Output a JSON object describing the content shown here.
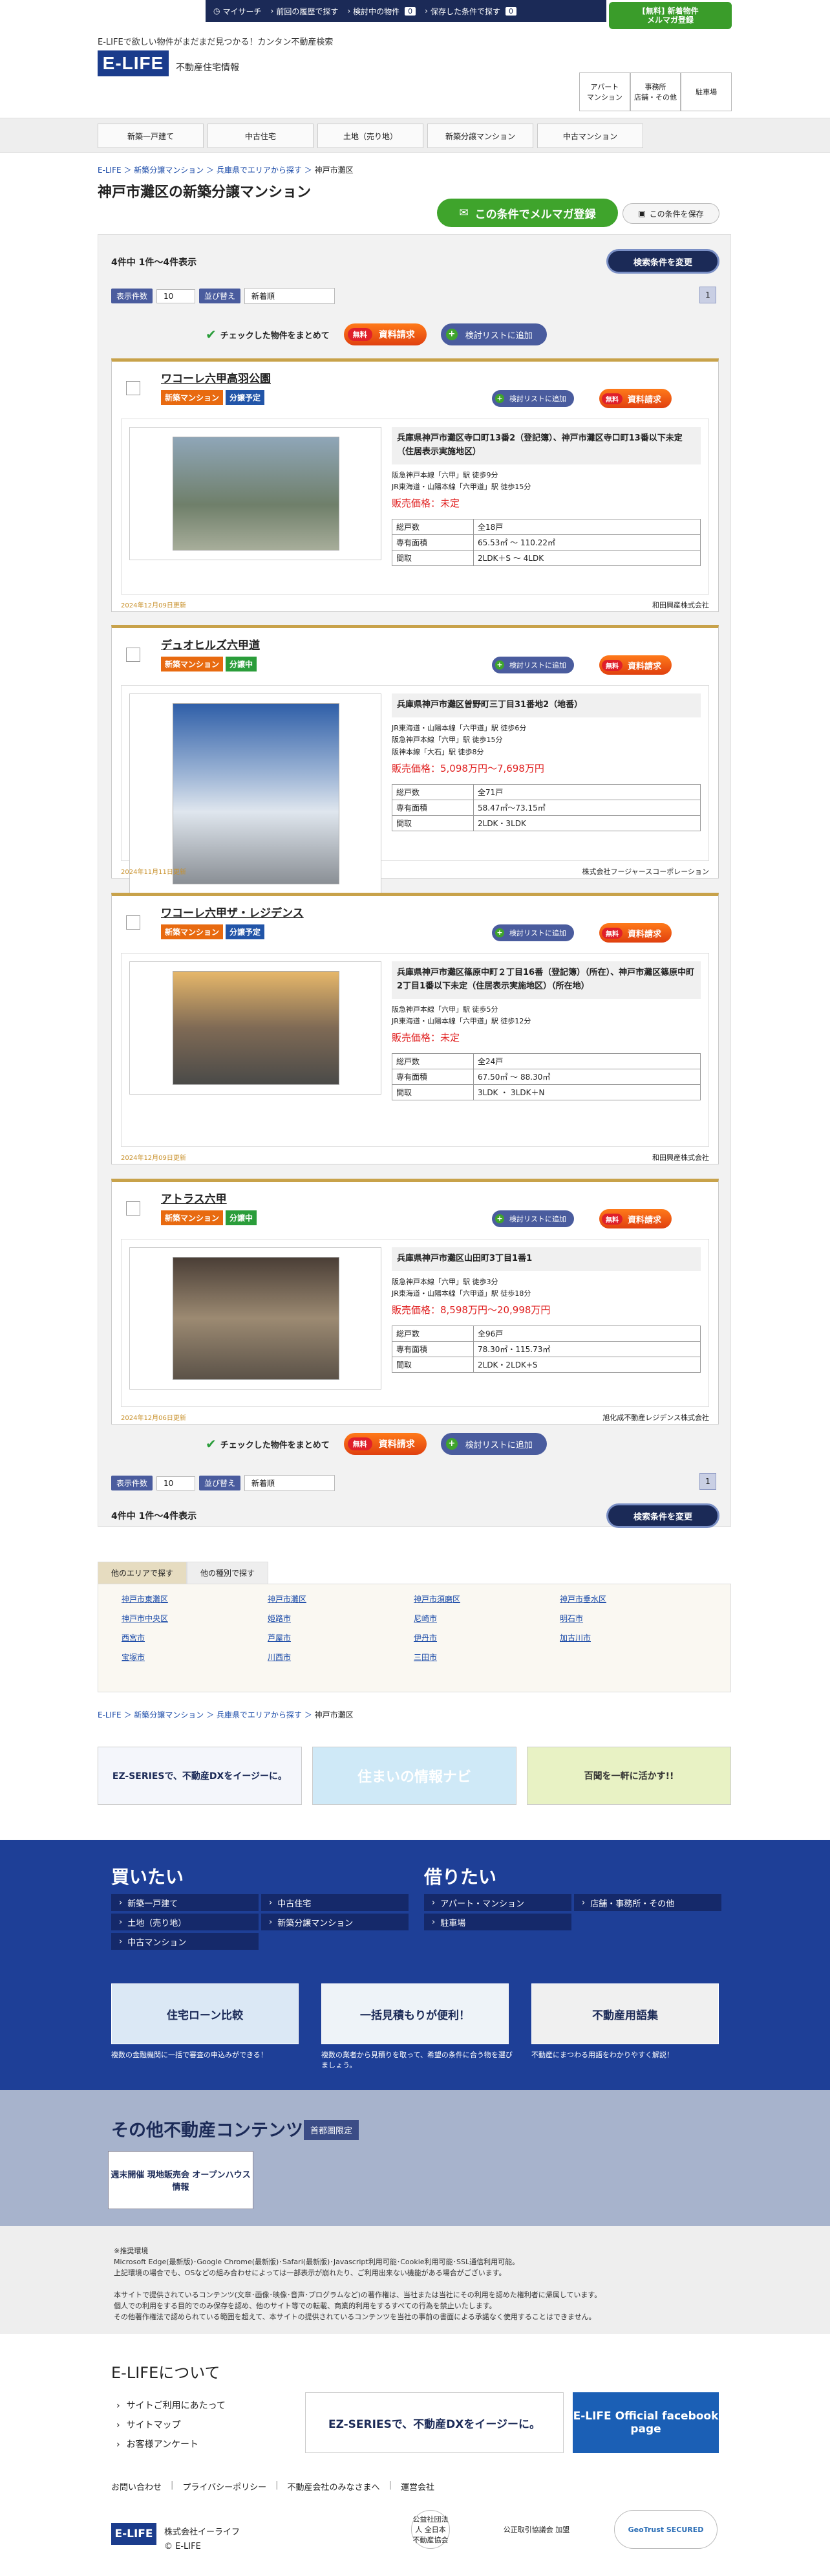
{
  "topnav": {
    "mysearch": "マイサーチ",
    "history": "前回の履歴で探す",
    "considering": "検討中の物件",
    "considering_count": "0",
    "saved": "保存した条件で探す",
    "saved_count": "0",
    "mail_top": "[無料] 新着物件",
    "mail_bottom": "メルマガ登録"
  },
  "header": {
    "tagline": "E-LIFEで欲しい物件がまだまだ見つかる！カンタン不動産検索",
    "logo": "E-LIFE",
    "logo_sub": "不動産住宅情報",
    "boxes": [
      "アパート\nマンション",
      "事務所\n店舗・その他",
      "駐車場"
    ]
  },
  "gnav": [
    "新築一戸建て",
    "中古住宅",
    "土地（売り地）",
    "新築分譲マンション",
    "中古マンション"
  ],
  "breadcrumb": [
    "E-LIFE",
    "新築分譲マンション",
    "兵庫県でエリアから探す",
    "神戸市灘区"
  ],
  "page_title": "神戸市灘区の新築分譲マンション",
  "buttons": {
    "mail_condition": "この条件でメルマガ登録",
    "save_condition": "この条件を保存",
    "change_condition": "検索条件を変更",
    "check_bulk": "チェックした物件をまとめて",
    "free": "無料",
    "request": "資料請求",
    "add_list": "検討リストに追加"
  },
  "result": {
    "count_label": "4件中 1件～4件表示",
    "per_page_label": "表示件数",
    "per_page_value": "10",
    "sort_label": "並び替え",
    "sort_value": "新着順",
    "page": "1"
  },
  "listings": [
    {
      "name": "ワコーレ六甲高羽公園",
      "tags": [
        {
          "text": "新築マンション",
          "c": "o"
        },
        {
          "text": "分譲予定",
          "c": "b"
        }
      ],
      "address": "兵庫県神戸市灘区寺口町13番2（登記簿）、神戸市灘区寺口町13番以下未定（住居表示実施地区）",
      "access": [
        "阪急神戸本線「六甲」駅 徒歩9分",
        "JR東海道・山陽本線「六甲道」駅 徒歩15分"
      ],
      "price": "販売価格：未定",
      "rows": [
        [
          "総戸数",
          "全18戸"
        ],
        [
          "専有面積",
          "65.53㎡ ～ 110.22㎡"
        ],
        [
          "間取",
          "2LDK＋S ～ 4LDK"
        ]
      ],
      "updated": "2024年12月09日更新",
      "company": "和田興産株式会社"
    },
    {
      "name": "デュオヒルズ六甲道",
      "tags": [
        {
          "text": "新築マンション",
          "c": "o"
        },
        {
          "text": "分譲中",
          "c": "g"
        }
      ],
      "address": "兵庫県神戸市灘区曽野町三丁目31番地2（地番）",
      "access": [
        "JR東海道・山陽本線「六甲道」駅 徒歩6分",
        "阪急神戸本線「六甲」駅 徒歩15分",
        "阪神本線「大石」駅 徒歩8分"
      ],
      "price": "販売価格：5,098万円～7,698万円",
      "rows": [
        [
          "総戸数",
          "全71戸"
        ],
        [
          "専有面積",
          "58.47㎡～73.15㎡"
        ],
        [
          "間取",
          "2LDK・3LDK"
        ]
      ],
      "updated": "2024年11月11日更新",
      "company": "株式会社フージャースコーポレーション"
    },
    {
      "name": "ワコーレ六甲ザ・レジデンス",
      "tags": [
        {
          "text": "新築マンション",
          "c": "o"
        },
        {
          "text": "分譲予定",
          "c": "b"
        }
      ],
      "address": "兵庫県神戸市灘区篠原中町２丁目16番（登記簿）（所在）、神戸市灘区篠原中町2丁目1番以下未定（住居表示実施地区）（所在地）",
      "access": [
        "阪急神戸本線「六甲」駅 徒歩5分",
        "JR東海道・山陽本線「六甲道」駅 徒歩12分"
      ],
      "price": "販売価格：未定",
      "rows": [
        [
          "総戸数",
          "全24戸"
        ],
        [
          "専有面積",
          "67.50㎡ ～ 88.30㎡"
        ],
        [
          "間取",
          "3LDK ・ 3LDK＋N"
        ]
      ],
      "updated": "2024年12月09日更新",
      "company": "和田興産株式会社"
    },
    {
      "name": "アトラス六甲",
      "tags": [
        {
          "text": "新築マンション",
          "c": "o"
        },
        {
          "text": "分譲中",
          "c": "g"
        }
      ],
      "address": "兵庫県神戸市灘区山田町3丁目1番1",
      "access": [
        "阪急神戸本線「六甲」駅 徒歩3分",
        "JR東海道・山陽本線「六甲道」駅 徒歩18分"
      ],
      "price": "販売価格：8,598万円～20,998万円",
      "rows": [
        [
          "総戸数",
          "全96戸"
        ],
        [
          "専有面積",
          "78.30㎡・115.73㎡"
        ],
        [
          "間取",
          "2LDK・2LDK+S"
        ]
      ],
      "updated": "2024年12月06日更新",
      "company": "旭化成不動産レジデンス株式会社"
    }
  ],
  "area_tabs": [
    "他のエリアで探す",
    "他の種別で探す"
  ],
  "areas": [
    "神戸市東灘区",
    "神戸市灘区",
    "神戸市須磨区",
    "神戸市垂水区",
    "神戸市中央区",
    "姫路市",
    "尼崎市",
    "明石市",
    "西宮市",
    "芦屋市",
    "伊丹市",
    "加古川市",
    "宝塚市",
    "川西市",
    "三田市"
  ],
  "banners": [
    "EZ-SERIESで、不動産DXをイージーに。",
    "住まいの情報ナビ",
    "百聞を一軒に活かす!!"
  ],
  "buy": {
    "title": "買いたい",
    "links": [
      "新築一戸建て",
      "中古住宅",
      "土地（売り地）",
      "新築分譲マンション",
      "中古マンション"
    ]
  },
  "rent": {
    "title": "借りたい",
    "links": [
      "アパート・マンション",
      "店舗・事務所・その他",
      "駐車場"
    ]
  },
  "promo": [
    {
      "title": "住宅ローン比較",
      "caption": "複数の金融機関に一括で審査の申込みができる！"
    },
    {
      "title": "一括見積もりが便利！",
      "caption": "複数の業者から見積りを取って、希望の条件に合う物を選びましょう。"
    },
    {
      "title": "不動産用語集",
      "caption": "不動産にまつわる用語をわかりやすく解説！"
    }
  ],
  "other": {
    "title": "その他不動産コンテンツ",
    "badge": "首都圏限定",
    "openhouse": "週末開催 現地販売会 オープンハウス情報"
  },
  "notes": "※推奨環境\nMicrosoft Edge(最新版)･Google Chrome(最新版)･Safari(最新版)･Javascript利用可能･Cookie利用可能･SSL通信利用可能。\n上記環境の場合でも、OSなどの組み合わせによっては一部表示が崩れたり、ご利用出来ない機能がある場合がございます。\n\n本サイトで提供されているコンテンツ(文章･画像･映像･音声･プログラムなど)の著作権は、当社または当社にその利用を認めた権利者に帰属しています。\n個人での利用をする目的でのみ保存を認め、他のサイト等での転載、商業的利用をするすべての行為を禁止いたします。\nその他著作権法で認められている範囲を超えて、本サイトの提供されているコンテンツを当社の事前の書面による承諾なく使用することはできません。",
  "about": {
    "title": "E-LIFEについて",
    "links": [
      "サイトご利用にあたって",
      "サイトマップ",
      "お客様アンケート"
    ],
    "ez": "EZ-SERIESで、不動産DXをイージーに。",
    "fb": "E-LIFE Official facebook page"
  },
  "footer_links": [
    "お問い合わせ",
    "プライバシーポリシー",
    "不動産会社のみなさまへ",
    "運営会社"
  ],
  "footer": {
    "logo": "E-LIFE",
    "company": "株式会社イーライフ",
    "copyright": "© E-LIFE",
    "seals": [
      "公益社団法人 全日本不動産協会",
      "公正取引協議会 加盟",
      "GeoTrust SECURED"
    ]
  }
}
